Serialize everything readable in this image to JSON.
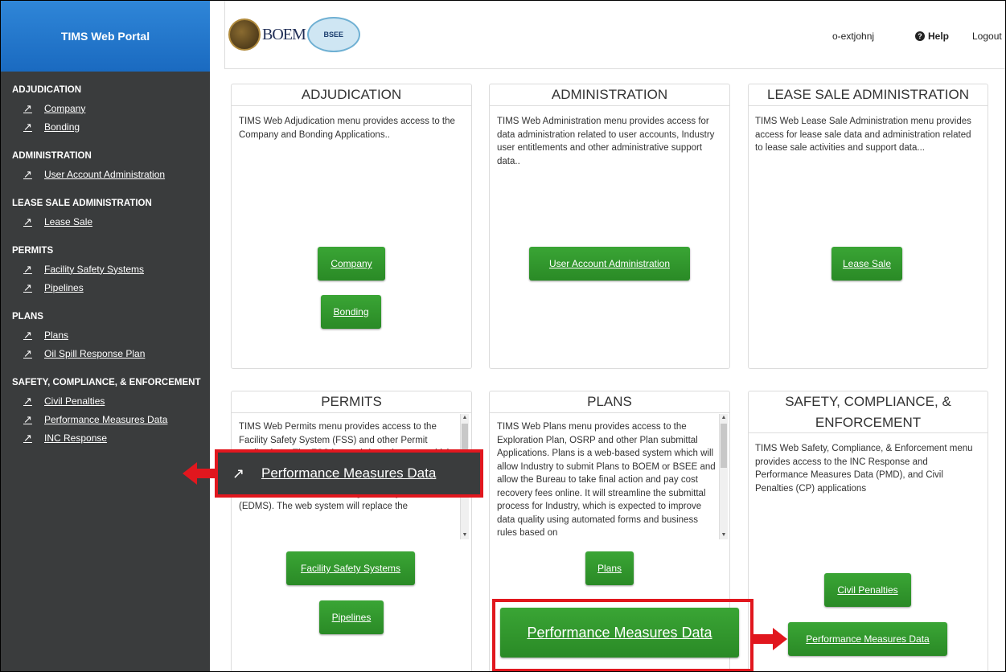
{
  "sidebar": {
    "brand": "TIMS Web Portal",
    "groups": [
      {
        "heading": "ADJUDICATION",
        "items": [
          "Company",
          "Bonding"
        ]
      },
      {
        "heading": "ADMINISTRATION",
        "items": [
          "User Account Administration"
        ]
      },
      {
        "heading": "LEASE SALE ADMINISTRATION",
        "items": [
          "Lease Sale"
        ]
      },
      {
        "heading": "PERMITS",
        "items": [
          "Facility Safety Systems",
          "Pipelines"
        ]
      },
      {
        "heading": "PLANS",
        "items": [
          "Plans",
          "Oil Spill Response Plan"
        ]
      },
      {
        "heading": "SAFETY, COMPLIANCE, & ENFORCEMENT",
        "items": [
          "Civil Penalties",
          "Performance Measures Data",
          "INC Response"
        ]
      }
    ]
  },
  "header": {
    "logo_boem": "BOEM",
    "logo_bsee": "BSEE",
    "user": "o-extjohnj",
    "help": "Help",
    "logout": "Logout"
  },
  "panels": {
    "adjudication": {
      "title": "ADJUDICATION",
      "desc": "TIMS Web Adjudication menu provides access to the Company and Bonding Applications..",
      "buttons": [
        "Company",
        "Bonding"
      ]
    },
    "administration": {
      "title": "ADMINISTRATION",
      "desc": "TIMS Web Administration menu provides access for data administration related to user accounts, Industry user entitlements and other administrative support data..",
      "buttons": [
        "User Account Administration"
      ]
    },
    "lease_sale": {
      "title": "LEASE SALE ADMINISTRATION",
      "desc": "TIMS Web Lease Sale Administration menu provides access for lease sale data and administration related to lease sale activities and support data...",
      "buttons": [
        "Lease Sale"
      ]
    },
    "permits": {
      "title": "PERMITS",
      "desc": "TIMS Web Permits menu provides access to the Facility Safety System (FSS) and other Permit applications. The FSS is a web-based system which will allow Operators to pay their application fees with links to pay.gov, and collect metadata needed for the Electronic Data Management System (EDMS). The web system will replace the",
      "buttons": [
        "Facility Safety Systems",
        "Pipelines"
      ]
    },
    "plans": {
      "title": "PLANS",
      "desc": "TIMS Web Plans menu provides access to the Exploration Plan, OSRP and other Plan submittal Applications. Plans is a web-based system which will allow Industry to submit Plans to BOEM or BSEE and allow the Bureau to take final action and pay cost recovery fees online. It will streamline the submittal process for Industry, which is expected to improve data quality using automated forms and business rules based on",
      "buttons": [
        "Plans"
      ]
    },
    "sce": {
      "title": "SAFETY, COMPLIANCE, & ENFORCEMENT",
      "desc": "TIMS Web Safety, Compliance, & Enforcement menu provides access to the INC Response and Performance Measures Data (PMD), and Civil Penalties (CP) applications",
      "buttons": [
        "Civil Penalties",
        "Performance Measures Data"
      ]
    }
  },
  "callouts": {
    "sidebar_zoom": "Performance Measures Data",
    "button_zoom": "Performance Measures Data"
  },
  "colors": {
    "sidebar_bg": "#3a3c3d",
    "brand_blue": "#1a6ac0",
    "button_green": "#2e8f2a",
    "callout_red": "#e1171e"
  }
}
